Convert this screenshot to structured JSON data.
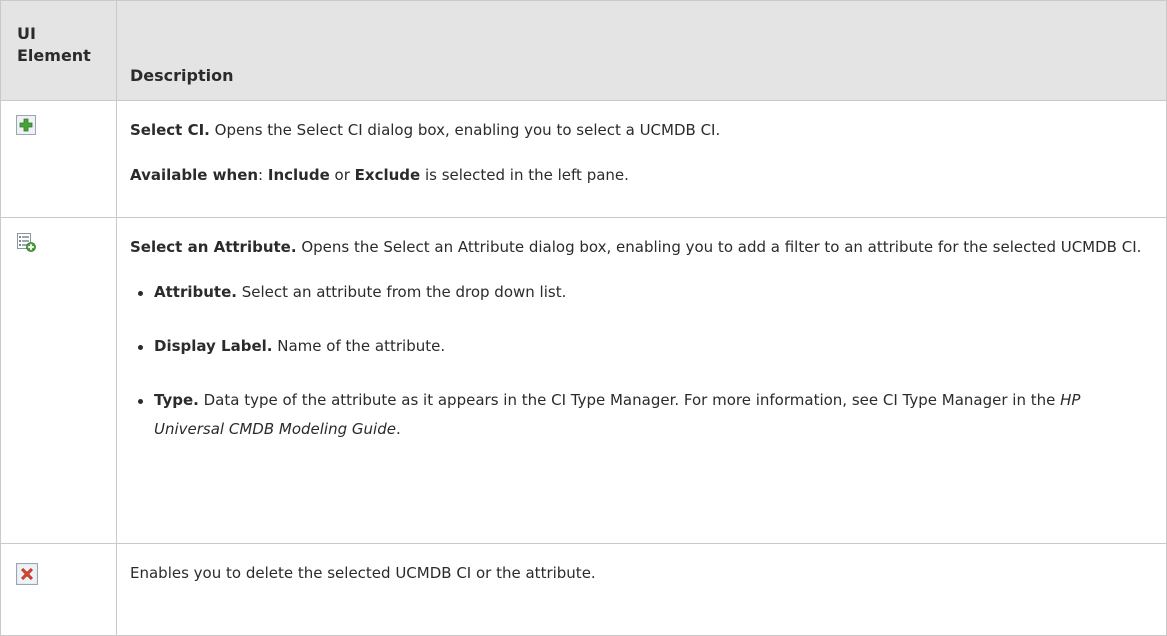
{
  "table": {
    "header": {
      "ui_element_line1": "UI",
      "ui_element_line2": "Element",
      "description": "Description"
    },
    "rows": [
      {
        "icon": "add-green-plus-icon",
        "p1": {
          "bold": "Select CI.",
          "text": " Opens the Select CI dialog box, enabling you to select a UCMDB CI."
        },
        "p2": {
          "bold1": "Available when",
          "sep": ": ",
          "bold2": "Include",
          "or": " or ",
          "bold3": "Exclude",
          "rest": " is selected in the left pane."
        }
      },
      {
        "icon": "select-attribute-list-add-icon",
        "p1": {
          "bold": "Select an Attribute.",
          "text": " Opens the Select an Attribute dialog box, enabling you to add a filter to an attribute for the selected UCMDB CI."
        },
        "bullets": [
          {
            "bold": "Attribute.",
            "text": " Select an attribute from the drop down list."
          },
          {
            "bold": "Display Label.",
            "text": " Name of the attribute."
          },
          {
            "bold": "Type.",
            "text": " Data type of the attribute as it appears in the CI Type Manager. For more information, see CI Type Manager in the ",
            "italic": "HP Universal CMDB Modeling Guide",
            "end": "."
          }
        ]
      },
      {
        "icon": "delete-red-x-icon",
        "p1": {
          "text": "Enables you to delete the selected UCMDB CI or the attribute."
        }
      }
    ]
  }
}
